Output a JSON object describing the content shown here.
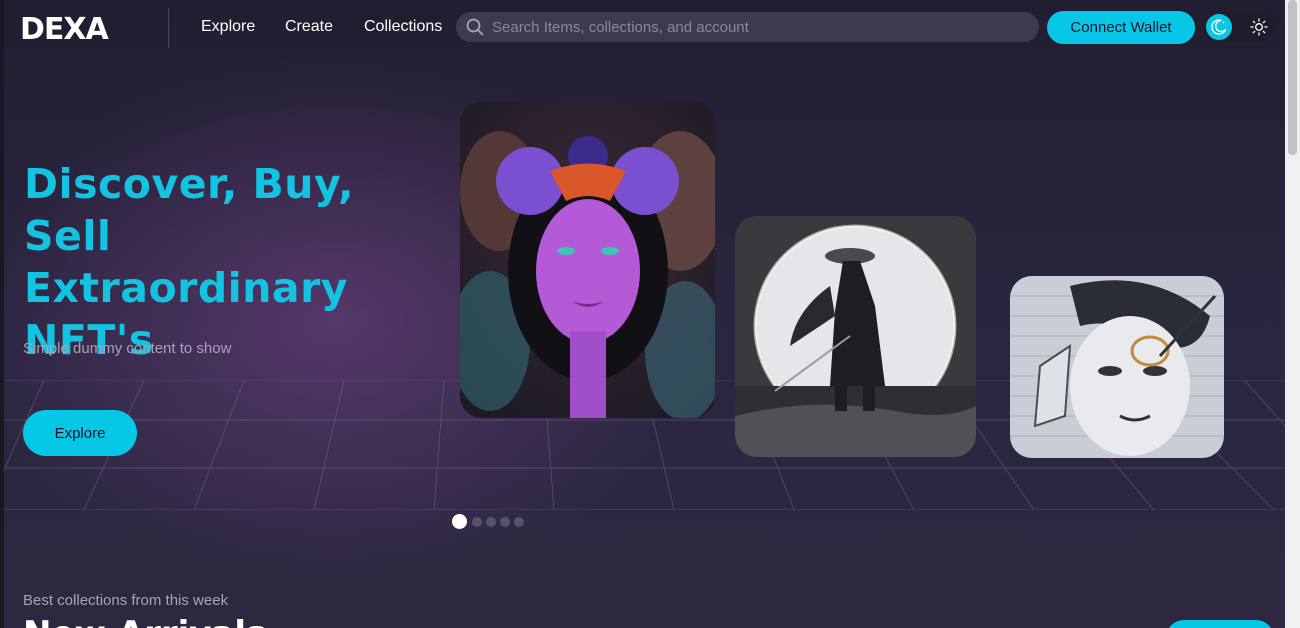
{
  "brand": {
    "logo_text": "DEXA"
  },
  "nav": {
    "items": [
      {
        "label": "Explore"
      },
      {
        "label": "Create"
      },
      {
        "label": "Collections"
      }
    ]
  },
  "search": {
    "placeholder": "Search Items, collections, and account"
  },
  "header": {
    "connect_label": "Connect Wallet"
  },
  "theme": {
    "dark_icon": "moon-icon",
    "light_icon": "sun-icon"
  },
  "hero": {
    "title_lines": [
      "Discover, Buy, Sell",
      "Extraordinary",
      "NFT's"
    ],
    "subtitle": "Simple dummy content to show",
    "explore_label": "Explore"
  },
  "carousel": {
    "slide_count": 5,
    "active_index": 0,
    "cards": [
      {
        "art": "psychedelic-woman-with-moth-crown-artwork"
      },
      {
        "art": "samurai-in-front-of-moon-artwork"
      },
      {
        "art": "graffiti-face-mural-artwork"
      }
    ]
  },
  "section": {
    "subtitle": "Best collections from this week",
    "title": "New Arrivals"
  },
  "colors": {
    "accent": "#06c7e6",
    "title": "#13c4e2",
    "background": "#2a2538"
  }
}
